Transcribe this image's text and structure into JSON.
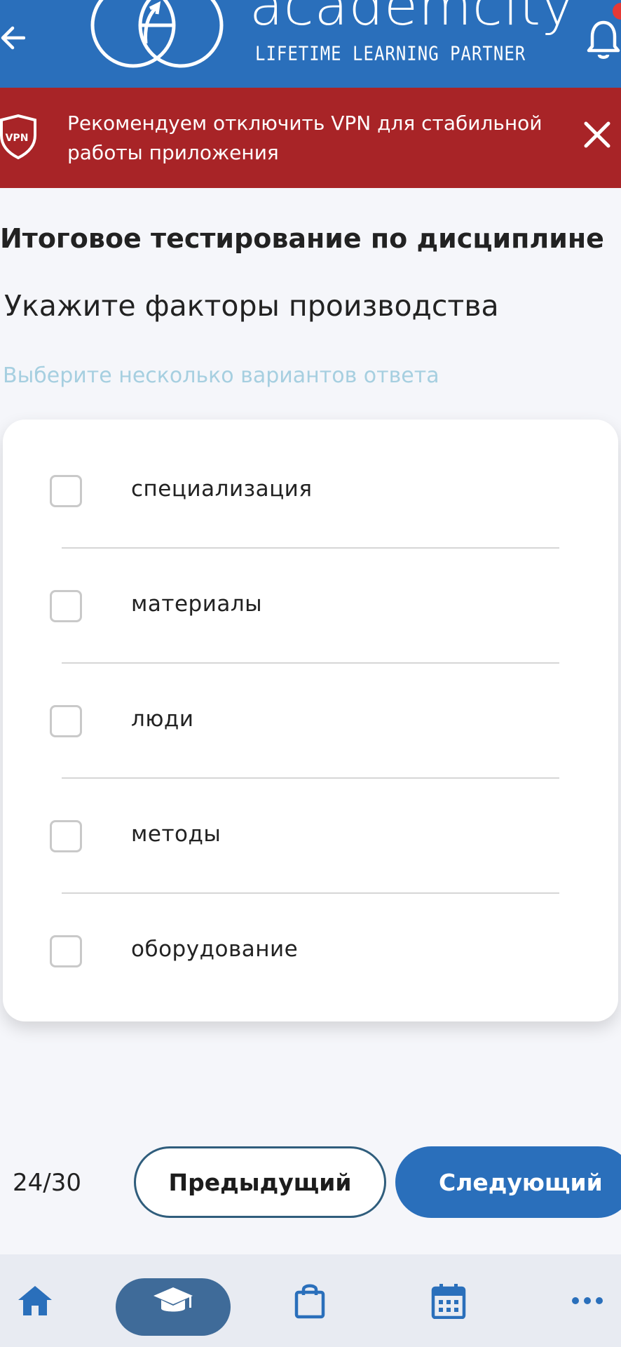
{
  "header": {
    "brand_name": "academcity",
    "brand_tagline": "LIFETIME LEARNING PARTNER",
    "back_icon": "arrow-left-icon",
    "bell_icon": "bell-icon",
    "color": "#2a6fbb"
  },
  "vpn_banner": {
    "badge": "VPN",
    "message": "Рекомендуем отключить VPN для стабильной работы приложения",
    "close_icon": "close-icon",
    "color": "#a82427"
  },
  "test": {
    "title": "Итоговое тестирование по дисциплине",
    "question": "Укажите факторы производства",
    "hint": "Выберите несколько вариантов ответа",
    "options": [
      {
        "label": "специализация",
        "checked": false
      },
      {
        "label": "материалы",
        "checked": false
      },
      {
        "label": "люди",
        "checked": false
      },
      {
        "label": "методы",
        "checked": false
      },
      {
        "label": "оборудование",
        "checked": false
      }
    ]
  },
  "navigation": {
    "counter": "24/30",
    "prev_label": "Предыдущий",
    "next_label": "Следующий"
  },
  "tabbar": {
    "items": [
      {
        "icon": "home-icon",
        "active": false
      },
      {
        "icon": "graduation-cap-icon",
        "active": true
      },
      {
        "icon": "shopping-bag-icon",
        "active": false
      },
      {
        "icon": "calendar-icon",
        "active": false
      },
      {
        "icon": "more-icon",
        "active": false
      }
    ]
  }
}
